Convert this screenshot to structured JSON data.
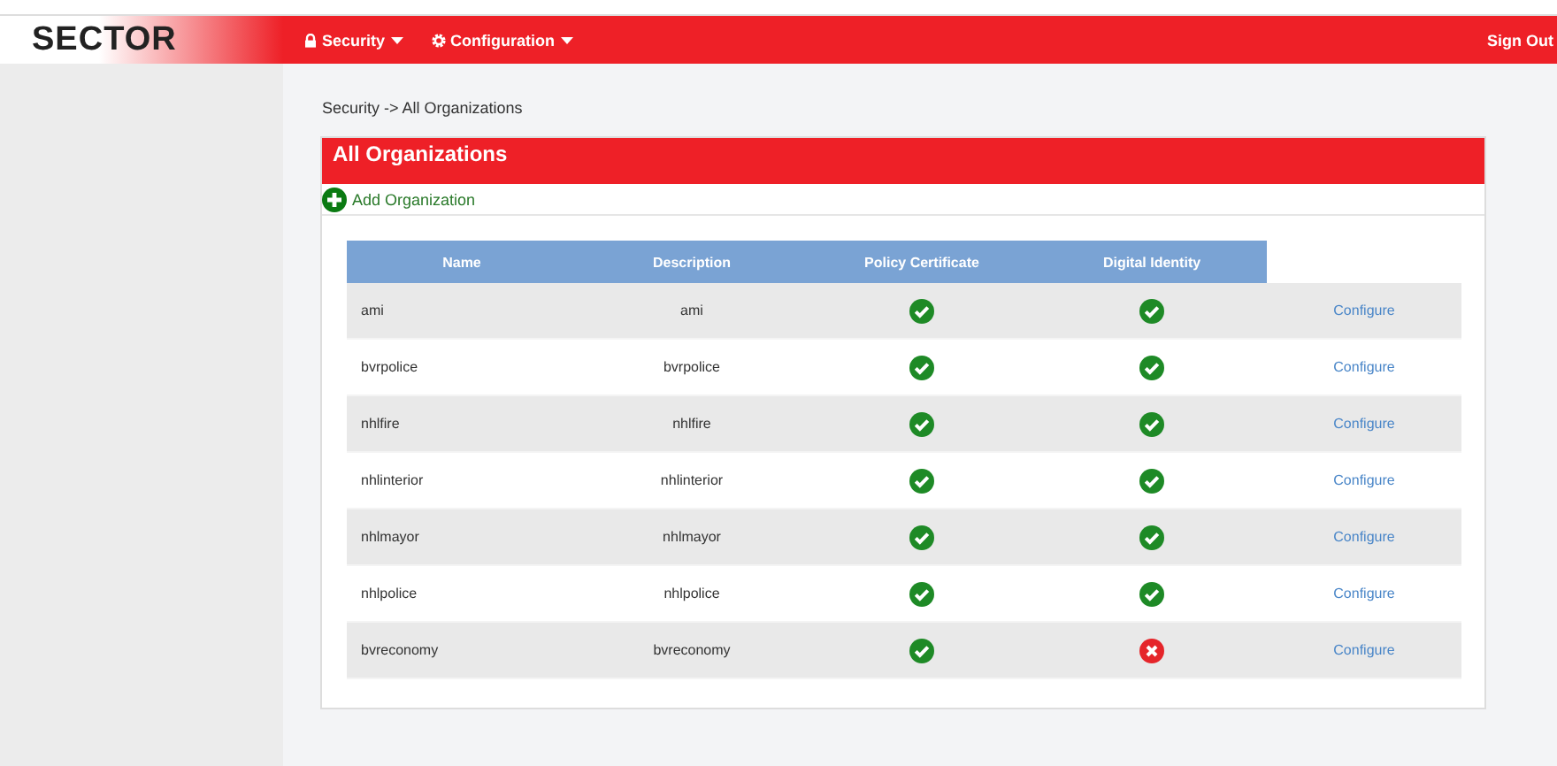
{
  "navbar": {
    "logo": "SECTOR",
    "menus": [
      {
        "label": "Security",
        "kind": "lock"
      },
      {
        "label": "Configuration",
        "kind": "gear"
      }
    ],
    "sign_out": "Sign Out"
  },
  "breadcrumb": "Security -> All Organizations",
  "panel": {
    "title": "All Organizations",
    "add_link": "Add Organization"
  },
  "table": {
    "columns": [
      "Name",
      "Description",
      "Policy Certificate",
      "Digital Identity"
    ],
    "rows": [
      {
        "name": "ami",
        "description": "ami",
        "policy_certificate": true,
        "digital_identity": true,
        "action": "Configure"
      },
      {
        "name": "bvrpolice",
        "description": "bvrpolice",
        "policy_certificate": true,
        "digital_identity": true,
        "action": "Configure"
      },
      {
        "name": "nhlfire",
        "description": "nhlfire",
        "policy_certificate": true,
        "digital_identity": true,
        "action": "Configure"
      },
      {
        "name": "nhlinterior",
        "description": "nhlinterior",
        "policy_certificate": true,
        "digital_identity": true,
        "action": "Configure"
      },
      {
        "name": "nhlmayor",
        "description": "nhlmayor",
        "policy_certificate": true,
        "digital_identity": true,
        "action": "Configure"
      },
      {
        "name": "nhlpolice",
        "description": "nhlpolice",
        "policy_certificate": true,
        "digital_identity": true,
        "action": "Configure"
      },
      {
        "name": "bvreconomy",
        "description": "bvreconomy",
        "policy_certificate": true,
        "digital_identity": false,
        "action": "Configure"
      }
    ]
  }
}
